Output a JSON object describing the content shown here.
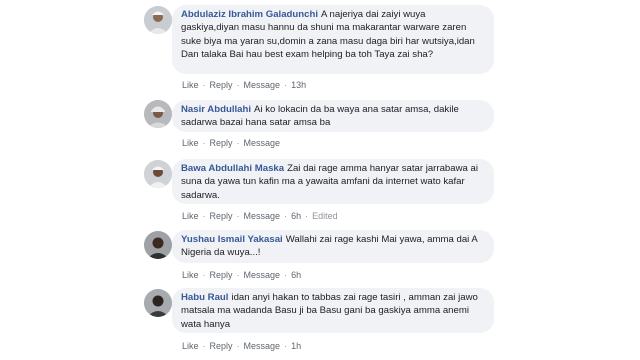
{
  "comments": [
    {
      "author": "Abdulaziz Ibrahim Galadunchi",
      "text": "A najeriya dai zaiyi wuya gaskiya,diyan masu hannu da shuni ma makarantar warware zaren suke biya ma yaran su,domin a zana masu daga biri har wutsiya,idan Dan talaka Bai hau best exam helping ba toh Taya zai sha?",
      "actions": {
        "like": "Like",
        "reply": "Reply",
        "message": "Message",
        "time": "13h",
        "edited": ""
      },
      "avatar": "avatar-white-cap"
    },
    {
      "author": "Nasir Abdullahi",
      "text": "Ai ko lokacin da ba waya ana satar amsa, dakile sadarwa bazai hana satar amsa ba",
      "actions": {
        "like": "Like",
        "reply": "Reply",
        "message": "Message",
        "time": "",
        "edited": ""
      },
      "avatar": "avatar-turban"
    },
    {
      "author": "Bawa Abdullahi Maska",
      "text": "Zai dai rage amma hanyar satar jarrabawa ai suna da yawa tun kafin ma a yawaita amfani da internet wato kafar sadarwa.",
      "actions": {
        "like": "Like",
        "reply": "Reply",
        "message": "Message",
        "time": "6h",
        "edited": "Edited"
      },
      "avatar": "avatar-white-cap"
    },
    {
      "author": "Yushau Ismail Yakasai",
      "text": "Wallahi zai rage kashi Mai yawa, amma dai A Nigeria da wuya...!",
      "actions": {
        "like": "Like",
        "reply": "Reply",
        "message": "Message",
        "time": "6h",
        "edited": ""
      },
      "avatar": "avatar-dark"
    },
    {
      "author": "Habu Raul",
      "text": "idan anyi hakan to tabbas zai rage tasiri , amman zai jawo matsala ma wadanda Basu ji ba Basu gani ba gaskiya amma anemi wata hanya",
      "actions": {
        "like": "Like",
        "reply": "Reply",
        "message": "Message",
        "time": "1h",
        "edited": ""
      },
      "avatar": "avatar-dark"
    }
  ],
  "colors": {
    "author": "#385898",
    "bubble": "#f0f2f5",
    "meta": "#606770"
  }
}
